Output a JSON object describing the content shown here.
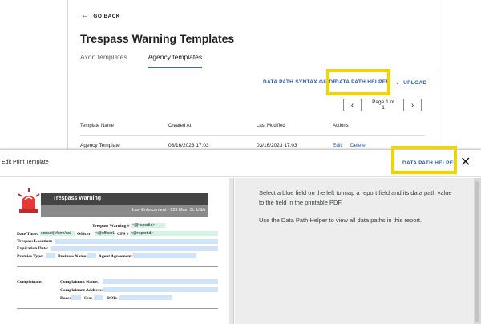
{
  "page": {
    "go_back": "GO BACK",
    "title": "Trespass Warning Templates",
    "tabs": [
      {
        "label": "Axon templates",
        "active": false
      },
      {
        "label": "Agency templates",
        "active": true
      }
    ],
    "actions": {
      "syntax_guide": "DATA PATH SYNTAX GUIDE",
      "helper": "DATA PATH HELPER",
      "upload": "UPLOAD"
    },
    "pager": {
      "label": "Page 1 of 1"
    },
    "table": {
      "columns": [
        "Template Name",
        "Created At",
        "Last Modified",
        "Actions"
      ],
      "rows": [
        {
          "name": "Agency Template",
          "created": "03/16/2023 17:03",
          "modified": "03/16/2023 17:03",
          "edit": "Edit",
          "delete": "Delete"
        }
      ]
    }
  },
  "modal": {
    "title": "Edit Print Template",
    "helper": "DATA PATH HELPER",
    "instructions_1": "Select a blue field on the left to map a report field and its data path value to the field in the printable PDF.",
    "instructions_2": "Use the Data Path Helper to view all data paths in this report."
  },
  "document": {
    "banner_title": "Trespass Warning",
    "banner_sub": "Law Enforcement - 123 Main St. USA",
    "labels": {
      "warning_no": "Trespass Warning #",
      "date_time": "Date/Time:",
      "officer": "Officer:",
      "cfs": "CFS #",
      "location": "Trespass Location:",
      "expiration": "Expiration Date:",
      "premise": "Premise Type:",
      "business": "Business Name:",
      "agent": "Agent Agreement:",
      "complainant": "Complainant:",
      "complainant_name": "Complainant Name:",
      "complainant_address": "Complainant Address:",
      "race": "Race:",
      "sex": "Sex:",
      "dob": "DOB:"
    },
    "mapped": {
      "warning_no": "<@reportId>",
      "date_time": "concat(<form/us/",
      "officer": "<@officerL",
      "cfs": "<@reportId>"
    }
  },
  "colors": {
    "accent": "#2a5db0",
    "highlight": "#f4d400",
    "field_unmapped": "#cfe3fb",
    "field_mapped": "#d2f4e2"
  }
}
